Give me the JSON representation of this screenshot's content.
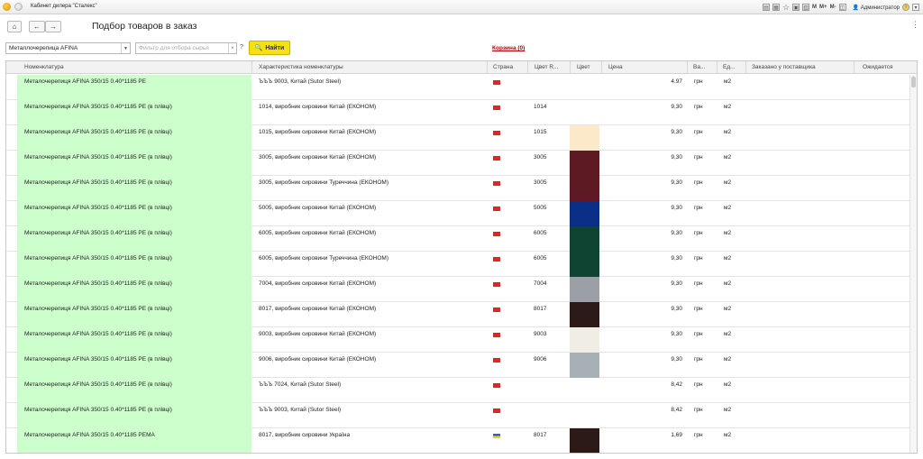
{
  "window": {
    "title": "Кабинет дилера \"Сталекс\"",
    "buttons": [
      "M",
      "M+",
      "M-"
    ],
    "user": "Администратор"
  },
  "header": {
    "title": "Подбор товаров в заказ",
    "more": "⋮"
  },
  "filters": {
    "category_value": "Металлочерепица AFINA",
    "search_placeholder": "Фильтр для отбора сырья",
    "search_value": "",
    "clear": "×",
    "help": "?",
    "find_label": "Найти",
    "cart_label": "Корзина (0)"
  },
  "table": {
    "columns": [
      "Номенклатура",
      "Характеристика номенклатуры",
      "Страна",
      "Цвет R...",
      "Цвет",
      "Цена",
      "Ва...",
      "Ед...",
      "Заказано у поставщика",
      "Ожидается"
    ],
    "rows": [
      {
        "name": "Металочерепиця AFINA 350/15 0.40*1185 PE",
        "char": "ЪЪЪ 9003, Китай (Sutor Steel)",
        "country": "cn",
        "ral": "",
        "color": "",
        "price": "4.97",
        "currency": "грн",
        "unit": "м2"
      },
      {
        "name": "Металочерепиця AFINA 350/15 0.40*1185 PE (в плівці)",
        "char": "1014, виробник сировини Китай (ЕКОНОМ)",
        "country": "cn",
        "ral": "1014",
        "color": "",
        "price": "9,30",
        "currency": "грн",
        "unit": "м2"
      },
      {
        "name": "Металочерепиця AFINA 350/15 0.40*1185 PE (в плівці)",
        "char": "1015, виробник сировини Китай (ЕКОНОМ)",
        "country": "cn",
        "ral": "1015",
        "color": "#fbe9c9",
        "price": "9,30",
        "currency": "грн",
        "unit": "м2"
      },
      {
        "name": "Металочерепиця AFINA 350/15 0.40*1185 PE (в плівці)",
        "char": "3005, виробник сировини Китай (ЕКОНОМ)",
        "country": "cn",
        "ral": "3005",
        "color": "#5e1a22",
        "price": "9,30",
        "currency": "грн",
        "unit": "м2"
      },
      {
        "name": "Металочерепиця AFINA 350/15 0.40*1185 PE (в плівці)",
        "char": "3005, виробник сировини Туреччина (ЕКОНОМ)",
        "country": "cn",
        "ral": "3005",
        "color": "#5e1a22",
        "price": "9,30",
        "currency": "грн",
        "unit": "м2"
      },
      {
        "name": "Металочерепиця AFINA 350/15 0.40*1185 PE (в плівці)",
        "char": "5005, виробник сировини Китай (ЕКОНОМ)",
        "country": "cn",
        "ral": "5005",
        "color": "#0b2f87",
        "price": "9,30",
        "currency": "грн",
        "unit": "м2"
      },
      {
        "name": "Металочерепиця AFINA 350/15 0.40*1185 PE (в плівці)",
        "char": "6005, виробник сировини Китай (ЕКОНОМ)",
        "country": "cn",
        "ral": "6005",
        "color": "#0f4332",
        "price": "9,30",
        "currency": "грн",
        "unit": "м2"
      },
      {
        "name": "Металочерепиця AFINA 350/15 0.40*1185 PE (в плівці)",
        "char": "6005, виробник сировини Туреччина (ЕКОНОМ)",
        "country": "cn",
        "ral": "6005",
        "color": "#0f4332",
        "price": "9,30",
        "currency": "грн",
        "unit": "м2"
      },
      {
        "name": "Металочерепиця AFINA 350/15 0.40*1185 PE (в плівці)",
        "char": "7004, виробник сировини Китай (ЕКОНОМ)",
        "country": "cn",
        "ral": "7004",
        "color": "#9d9fa6",
        "price": "9,30",
        "currency": "грн",
        "unit": "м2"
      },
      {
        "name": "Металочерепиця AFINA 350/15 0.40*1185 PE (в плівці)",
        "char": "8017, виробник сировини Китай (ЕКОНОМ)",
        "country": "cn",
        "ral": "8017",
        "color": "#2c1a19",
        "price": "9,30",
        "currency": "грн",
        "unit": "м2"
      },
      {
        "name": "Металочерепиця AFINA 350/15 0.40*1185 PE (в плівці)",
        "char": "9003, виробник сировини Китай (ЕКОНОМ)",
        "country": "cn",
        "ral": "9003",
        "color": "#f0ede5",
        "price": "9,30",
        "currency": "грн",
        "unit": "м2"
      },
      {
        "name": "Металочерепиця AFINA 350/15 0.40*1185 PE (в плівці)",
        "char": "9006, виробник сировини Китай (ЕКОНОМ)",
        "country": "cn",
        "ral": "9006",
        "color": "#a6b0b5",
        "price": "9,30",
        "currency": "грн",
        "unit": "м2"
      },
      {
        "name": "Металочерепиця AFINA 350/15 0.40*1185 PE (в плівці)",
        "char": "ЪЪЪ 7024, Китай (Sutor Steel)",
        "country": "cn",
        "ral": "",
        "color": "",
        "price": "8,42",
        "currency": "грн",
        "unit": "м2"
      },
      {
        "name": "Металочерепиця AFINA 350/15 0.40*1185 PE (в плівці)",
        "char": "ЪЪЪ 9003, Китай (Sutor Steel)",
        "country": "cn",
        "ral": "",
        "color": "",
        "price": "8,42",
        "currency": "грн",
        "unit": "м2"
      },
      {
        "name": "Металочерепиця AFINA 350/15 0.40*1185 PEMA",
        "char": "8017, виробник сировини Україна",
        "country": "ua",
        "ral": "8017",
        "color": "#2c1a19",
        "price": "1,69",
        "currency": "грн",
        "unit": "м2"
      }
    ]
  },
  "colors": {
    "name_bg": "#ccffcc",
    "find_button": "#f4e10f",
    "cart_link": "#b00000",
    "flag_cn": "#e0242a",
    "flag_ua_top": "#2c5fd6",
    "flag_ua_bottom": "#f7d117"
  }
}
